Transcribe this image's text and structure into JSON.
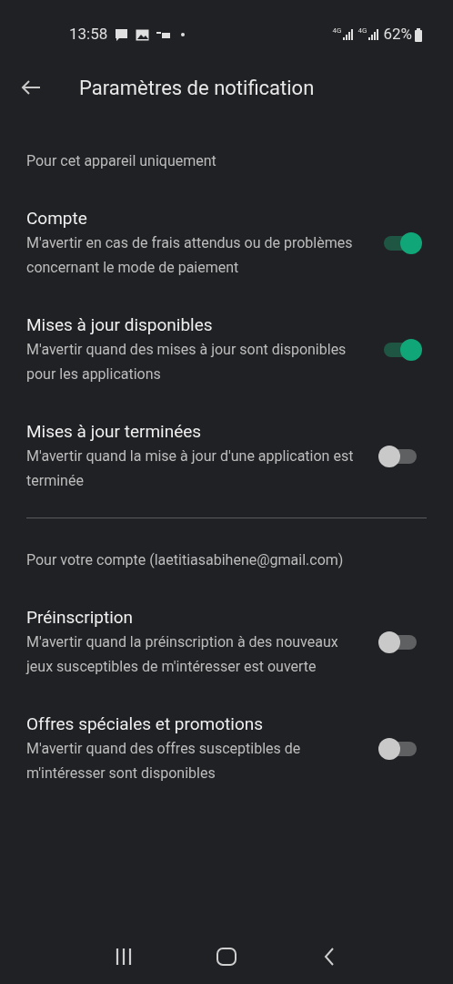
{
  "status_bar": {
    "time": "13:58",
    "network_1": "4G",
    "network_2": "4G",
    "battery": "62%"
  },
  "header": {
    "title": "Paramètres de notification"
  },
  "sections": [
    {
      "header": "Pour cet appareil uniquement",
      "items": [
        {
          "title": "Compte",
          "description": "M'avertir en cas de frais attendus ou de problèmes concernant le mode de paiement",
          "on": true
        },
        {
          "title": "Mises à jour disponibles",
          "description": "M'avertir quand des mises à jour sont disponibles pour les applications",
          "on": true
        },
        {
          "title": "Mises à jour terminées",
          "description": "M'avertir quand la mise à jour d'une application est terminée",
          "on": false
        }
      ]
    },
    {
      "header": "Pour votre compte (laetitiasabihene@gmail.com)",
      "items": [
        {
          "title": "Préinscription",
          "description": "M'avertir quand la préinscription à des nouveaux jeux susceptibles de m'intéresser est ouverte",
          "on": false
        },
        {
          "title": "Offres spéciales et promotions",
          "description": "M'avertir quand des offres susceptibles de m'intéresser sont disponibles",
          "on": false
        }
      ]
    }
  ]
}
